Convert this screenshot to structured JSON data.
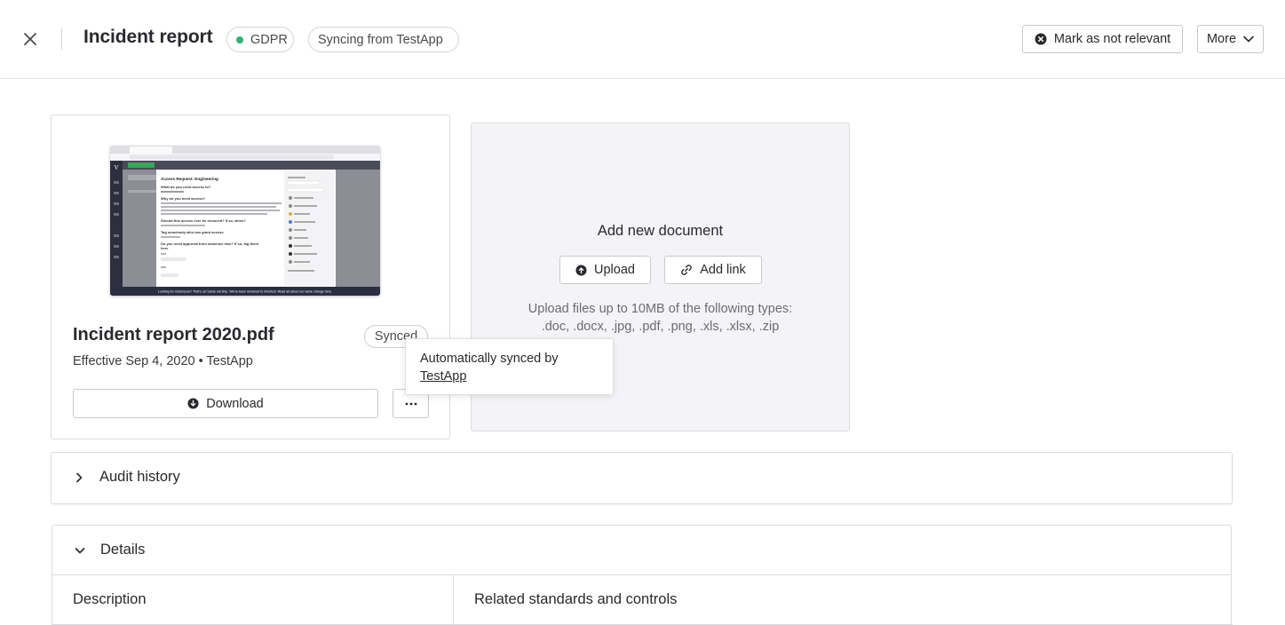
{
  "header": {
    "title": "Incident report",
    "badges": {
      "gdpr": "GDPR",
      "sync": "Syncing from TestApp"
    },
    "status_color": "#2fb36d",
    "mark_label": "Mark as not relevant",
    "more_label": "More"
  },
  "document": {
    "name": "Incident report 2020.pdf",
    "status_badge": "Synced",
    "meta": "Effective Sep 4, 2020 • TestApp",
    "download_label": "Download",
    "preview": {
      "page_title": "Access Request: Engineering",
      "questions": [
        "What do you need access to?",
        "Why do you need access?",
        "Should this access ever be removed? If so, when?",
        "Tag somebody who can grant access",
        "Do you need approval from someone else? If so, tag them here"
      ],
      "banner": "Looking for Clubhouse? That's us! Same old ship. We've been renamed to Shortcut. Read all about our name change here."
    }
  },
  "tooltip": {
    "text": "Automatically synced by",
    "link": "TestApp"
  },
  "add_document": {
    "title": "Add new document",
    "upload_label": "Upload",
    "link_label": "Add link",
    "help_line1": "Upload files up to 10MB of the following types:",
    "help_line2": ".doc, .docx, .jpg, .pdf, .png, .xls, .xlsx, .zip"
  },
  "audit": {
    "title": "Audit history"
  },
  "details": {
    "title": "Details",
    "description_label": "Description",
    "related_label": "Related standards and controls"
  }
}
